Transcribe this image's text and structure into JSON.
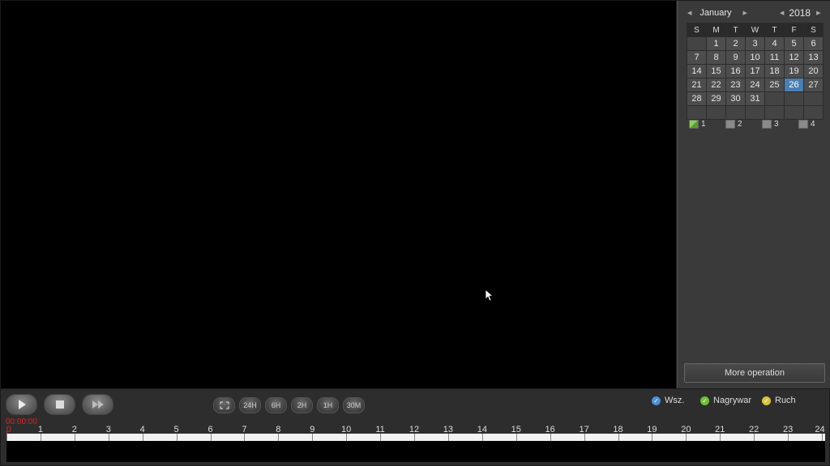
{
  "calendar": {
    "month": "January",
    "year": "2018",
    "weekdays": [
      "S",
      "M",
      "T",
      "W",
      "T",
      "F",
      "S"
    ],
    "weeks": [
      [
        "",
        "1",
        "2",
        "3",
        "4",
        "5",
        "6"
      ],
      [
        "7",
        "8",
        "9",
        "10",
        "11",
        "12",
        "13"
      ],
      [
        "14",
        "15",
        "16",
        "17",
        "18",
        "19",
        "20"
      ],
      [
        "21",
        "22",
        "23",
        "24",
        "25",
        "26",
        "27"
      ],
      [
        "28",
        "29",
        "30",
        "31",
        "",
        "",
        ""
      ],
      [
        "",
        "",
        "",
        "",
        "",
        "",
        ""
      ]
    ],
    "selected_day": "26",
    "selected_color": "#4a7fb2"
  },
  "channels": [
    {
      "label": "1",
      "checked": true
    },
    {
      "label": "2",
      "checked": false
    },
    {
      "label": "3",
      "checked": false
    },
    {
      "label": "4",
      "checked": false
    }
  ],
  "more_operation_label": "More operation",
  "controls": {
    "zoom_buttons": [
      "24H",
      "6H",
      "2H",
      "1H",
      "30M"
    ]
  },
  "legend": [
    {
      "label": "Wsz.",
      "color": "#4a90d9"
    },
    {
      "label": "Nagrywar",
      "color": "#6fbf3a"
    },
    {
      "label": "Ruch",
      "color": "#d4c43a"
    }
  ],
  "timeline": {
    "current_time": "00:00:00",
    "hours": [
      "0",
      "1",
      "2",
      "3",
      "4",
      "5",
      "6",
      "7",
      "8",
      "9",
      "10",
      "11",
      "12",
      "13",
      "14",
      "15",
      "16",
      "17",
      "18",
      "19",
      "20",
      "21",
      "22",
      "23",
      "24"
    ]
  }
}
